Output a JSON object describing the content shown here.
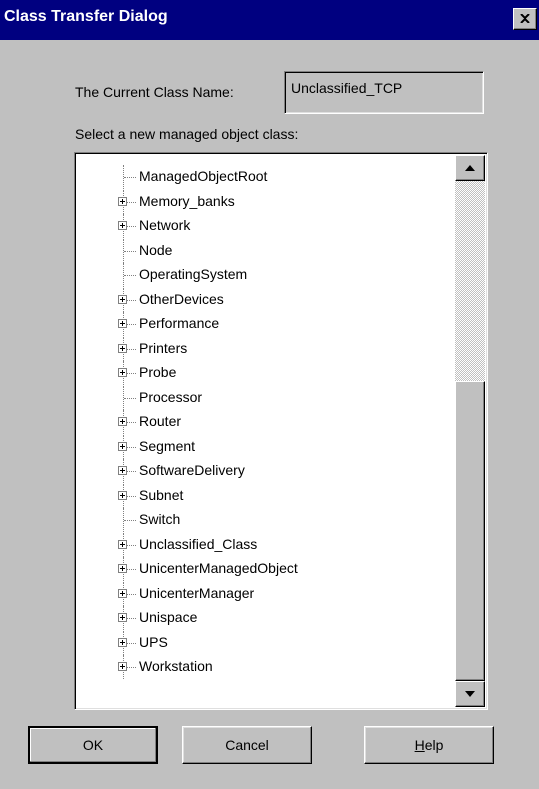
{
  "window": {
    "title": "Class Transfer Dialog"
  },
  "current_class": {
    "label": "The Current Class Name:",
    "value": "Unclassified_TCP"
  },
  "select_label": "Select a new managed object class:",
  "tree": {
    "items": [
      {
        "label": "ManagedObjectRoot",
        "expandable": false
      },
      {
        "label": "Memory_banks",
        "expandable": true
      },
      {
        "label": "Network",
        "expandable": true
      },
      {
        "label": "Node",
        "expandable": false
      },
      {
        "label": "OperatingSystem",
        "expandable": false
      },
      {
        "label": "OtherDevices",
        "expandable": true
      },
      {
        "label": "Performance",
        "expandable": true
      },
      {
        "label": "Printers",
        "expandable": true
      },
      {
        "label": "Probe",
        "expandable": true
      },
      {
        "label": "Processor",
        "expandable": false
      },
      {
        "label": "Router",
        "expandable": true
      },
      {
        "label": "Segment",
        "expandable": true
      },
      {
        "label": "SoftwareDelivery",
        "expandable": true
      },
      {
        "label": "Subnet",
        "expandable": true
      },
      {
        "label": "Switch",
        "expandable": false
      },
      {
        "label": "Unclassified_Class",
        "expandable": true
      },
      {
        "label": "UnicenterManagedObject",
        "expandable": true
      },
      {
        "label": "UnicenterManager",
        "expandable": true
      },
      {
        "label": "Unispace",
        "expandable": true
      },
      {
        "label": "UPS",
        "expandable": true
      },
      {
        "label": "Workstation",
        "expandable": true
      }
    ]
  },
  "buttons": {
    "ok": "OK",
    "cancel": "Cancel",
    "help_first": "H",
    "help_rest": "elp"
  },
  "colors": {
    "titlebar": "#000080",
    "face": "#c0c0c0"
  }
}
